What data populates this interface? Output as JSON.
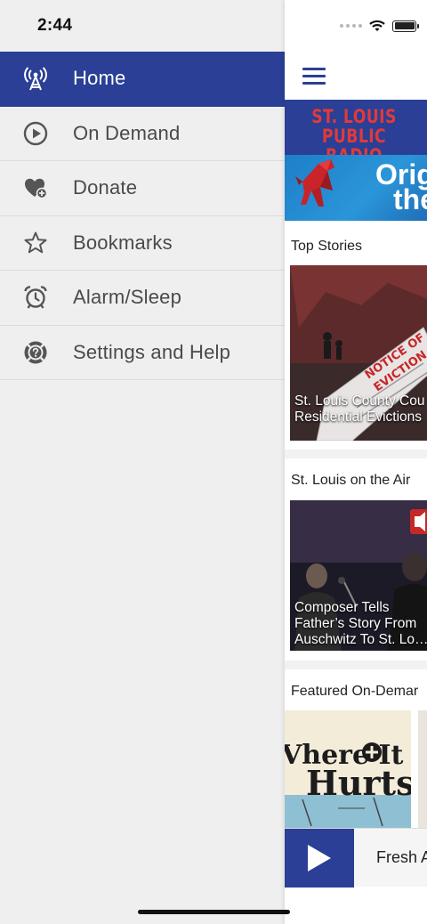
{
  "status_bar": {
    "time": "2:44"
  },
  "drawer": {
    "items": [
      {
        "label": "Home",
        "icon": "radio-tower-icon",
        "active": true
      },
      {
        "label": "On Demand",
        "icon": "play-circle-icon",
        "active": false
      },
      {
        "label": "Donate",
        "icon": "heart-plus-icon",
        "active": false
      },
      {
        "label": "Bookmarks",
        "icon": "star-icon",
        "active": false
      },
      {
        "label": "Alarm/Sleep",
        "icon": "alarm-clock-icon",
        "active": false
      },
      {
        "label": "Settings and Help",
        "icon": "settings-help-icon",
        "active": false
      }
    ]
  },
  "main": {
    "logo": {
      "line1": "ST. LOUIS",
      "line2": "PUBLIC RADIO"
    },
    "hero": {
      "line1": "Orig",
      "line2": "the"
    },
    "sections": [
      {
        "title": "Top Stories",
        "card_caption_line1": "St. Louis County Cou",
        "card_caption_line2": "Residential Evictions",
        "image_text_line1": "NOTICE OF",
        "image_text_line2": "EVICTION"
      },
      {
        "title": "St. Louis on the Air",
        "card_caption_line1": "Composer Tells",
        "card_caption_line2": "Father’s Story From",
        "card_caption_line3": "Auschwitz To St. Lo…"
      },
      {
        "title": "Featured On-Demar",
        "card_art_line1": "Vhere It",
        "card_art_line2": "Hurts"
      }
    ],
    "player": {
      "title": "Fresh A"
    }
  },
  "colors": {
    "brand_blue": "#2a3f95",
    "logo_red": "#e03a3a",
    "hero_blue": "#2b95d9"
  }
}
